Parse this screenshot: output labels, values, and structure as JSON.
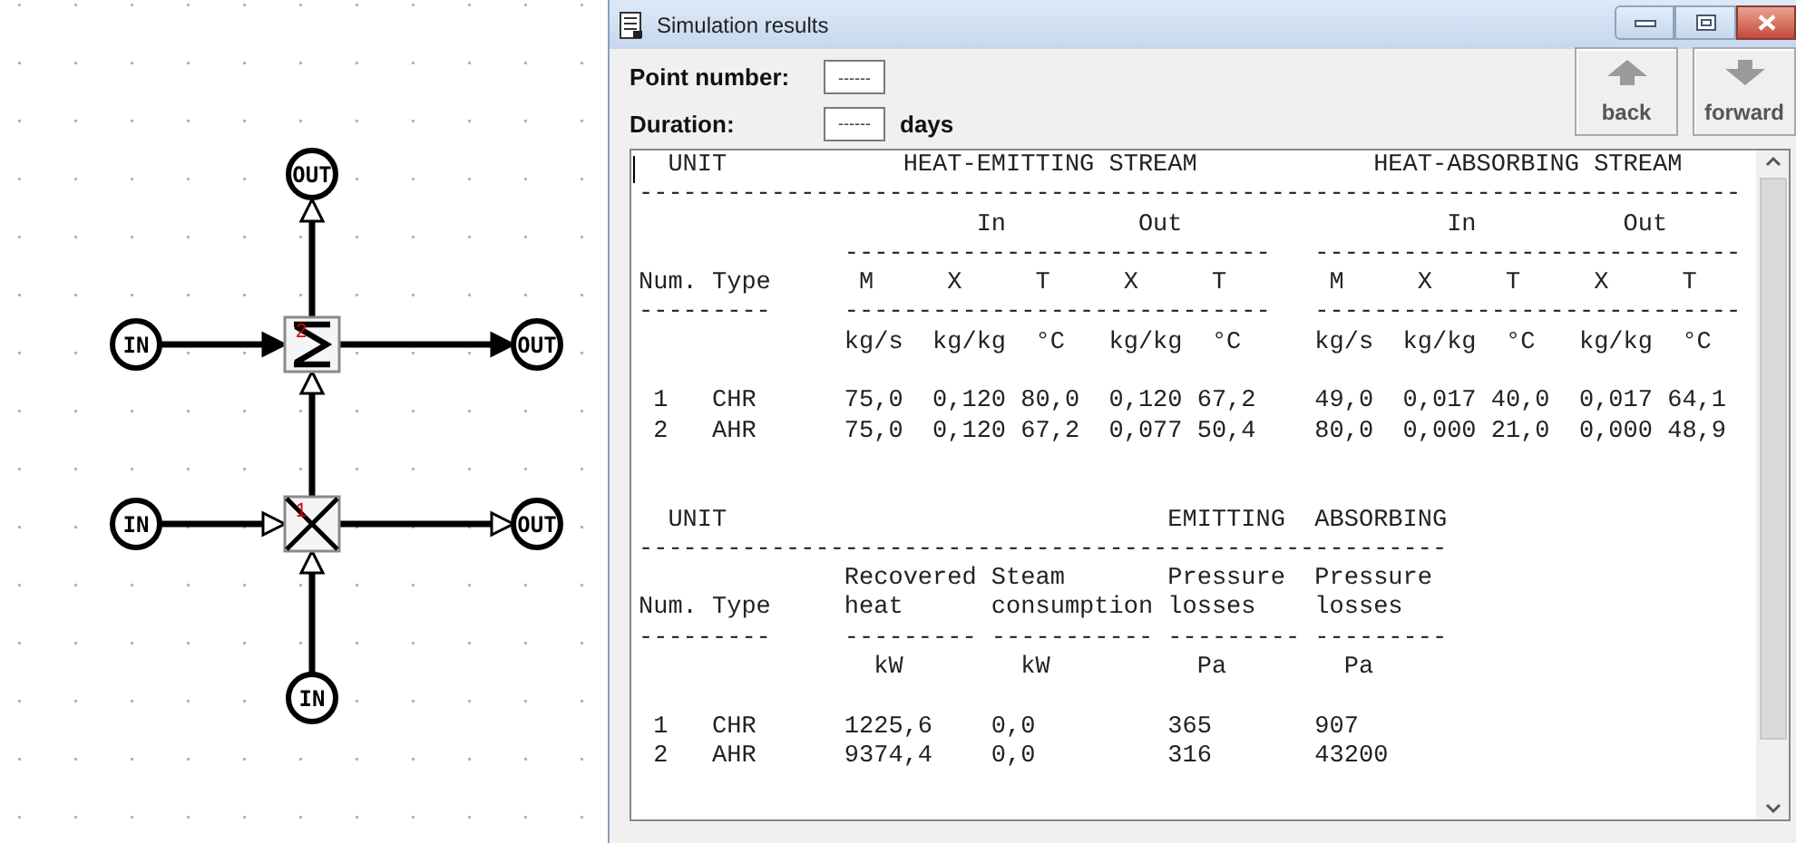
{
  "diagram": {
    "nodes": [
      {
        "label": "OUT"
      },
      {
        "label": "IN"
      },
      {
        "label": "OUT"
      },
      {
        "label": "IN"
      },
      {
        "label": "OUT"
      },
      {
        "label": "IN"
      }
    ],
    "units": [
      {
        "kind": "sum",
        "number": "2"
      },
      {
        "kind": "cross",
        "number": "1"
      }
    ],
    "connections": [
      {
        "kind": "hollow"
      },
      {
        "kind": "filled"
      },
      {
        "kind": "filled"
      },
      {
        "kind": "hollow"
      },
      {
        "kind": "hollow"
      },
      {
        "kind": "hollow"
      },
      {
        "kind": "hollow"
      }
    ]
  },
  "window": {
    "title": "Simulation results"
  },
  "fields": [
    {
      "label": "Point number:",
      "value": "------"
    },
    {
      "label": "Duration:",
      "value": "------",
      "unit": "days"
    }
  ],
  "nav_buttons": [
    {
      "kind": "up",
      "label": "back"
    },
    {
      "kind": "down",
      "label": "forward"
    }
  ],
  "report_lines": [
    {
      "kind": "text",
      "text": "  UNIT            HEAT-EMITTING STREAM            HEAT-ABSORBING STREAM"
    },
    {
      "kind": "text",
      "text": "---------------------------------------------------------------------------"
    },
    {
      "kind": "text",
      "text": "                       In         Out                  In          Out"
    },
    {
      "kind": "text",
      "text": "              -----------------------------   -----------------------------"
    },
    {
      "kind": "text",
      "text": "Num. Type      M     X     T     X     T       M     X     T     X     T"
    },
    {
      "kind": "text",
      "text": "---------     -----------------------------   -----------------------------"
    },
    {
      "kind": "text",
      "text": "              kg/s  kg/kg  °C   kg/kg  °C     kg/s  kg/kg  °C   kg/kg  °C"
    },
    {
      "kind": "blank"
    },
    {
      "kind": "text",
      "text": " 1   CHR      75,0  0,120 80,0  0,120 67,2    49,0  0,017 40,0  0,017 64,1"
    },
    {
      "kind": "text",
      "text": " 2   AHR      75,0  0,120 67,2  0,077 50,4    80,0  0,000 21,0  0,000 48,9"
    },
    {
      "kind": "blank"
    },
    {
      "kind": "blank"
    },
    {
      "kind": "text",
      "text": "  UNIT                              EMITTING  ABSORBING"
    },
    {
      "kind": "text",
      "text": "-------------------------------------------------------"
    },
    {
      "kind": "text",
      "text": "              Recovered Steam       Pressure  Pressure"
    },
    {
      "kind": "text",
      "text": "Num. Type     heat      consumption losses    losses"
    },
    {
      "kind": "text",
      "text": "---------     --------- ----------- --------- ---------"
    },
    {
      "kind": "text",
      "text": "                kW        kW          Pa        Pa"
    },
    {
      "kind": "blank"
    },
    {
      "kind": "text",
      "text": " 1   CHR      1225,6    0,0         365       907"
    },
    {
      "kind": "text",
      "text": " 2   AHR      9374,4    0,0         316       43200"
    }
  ]
}
